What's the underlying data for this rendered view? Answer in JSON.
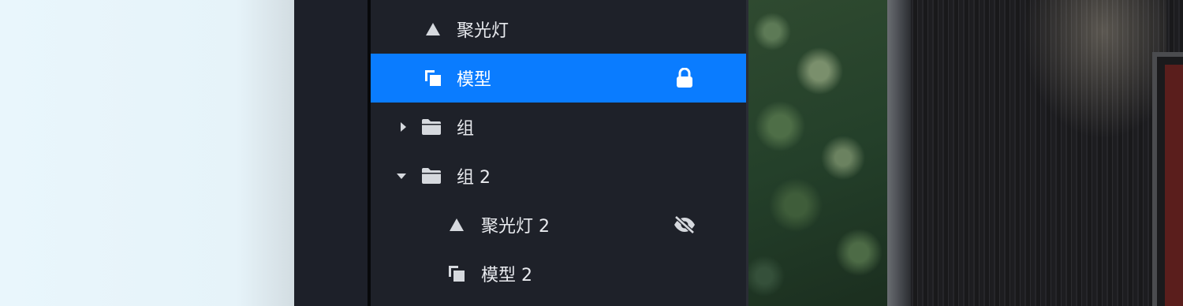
{
  "layers": [
    {
      "label": "聚光灯",
      "type": "spotlight",
      "caret": null,
      "state": null,
      "selected": false
    },
    {
      "label": "模型",
      "type": "model",
      "caret": null,
      "state": "lock",
      "selected": true
    },
    {
      "label": "组",
      "type": "folder",
      "caret": "right",
      "state": null,
      "selected": false
    },
    {
      "label": "组 2",
      "type": "folder",
      "caret": "down",
      "state": null,
      "selected": false
    },
    {
      "label": "聚光灯 2",
      "type": "spotlight",
      "caret": null,
      "state": "hidden",
      "selected": false
    },
    {
      "label": "模型 2",
      "type": "model",
      "caret": null,
      "state": null,
      "selected": false
    }
  ],
  "icons": {
    "spotlight": "triangle-icon",
    "model": "model-icon",
    "folder": "folder-icon",
    "caret_right": "caret-right-icon",
    "caret_down": "caret-down-icon",
    "lock": "lock-icon",
    "hidden": "eye-off-icon"
  },
  "colors": {
    "panel_bg": "#1e2129",
    "selected_bg": "#0a7cff",
    "text": "#e9ebef",
    "icon": "#d6d9de"
  }
}
